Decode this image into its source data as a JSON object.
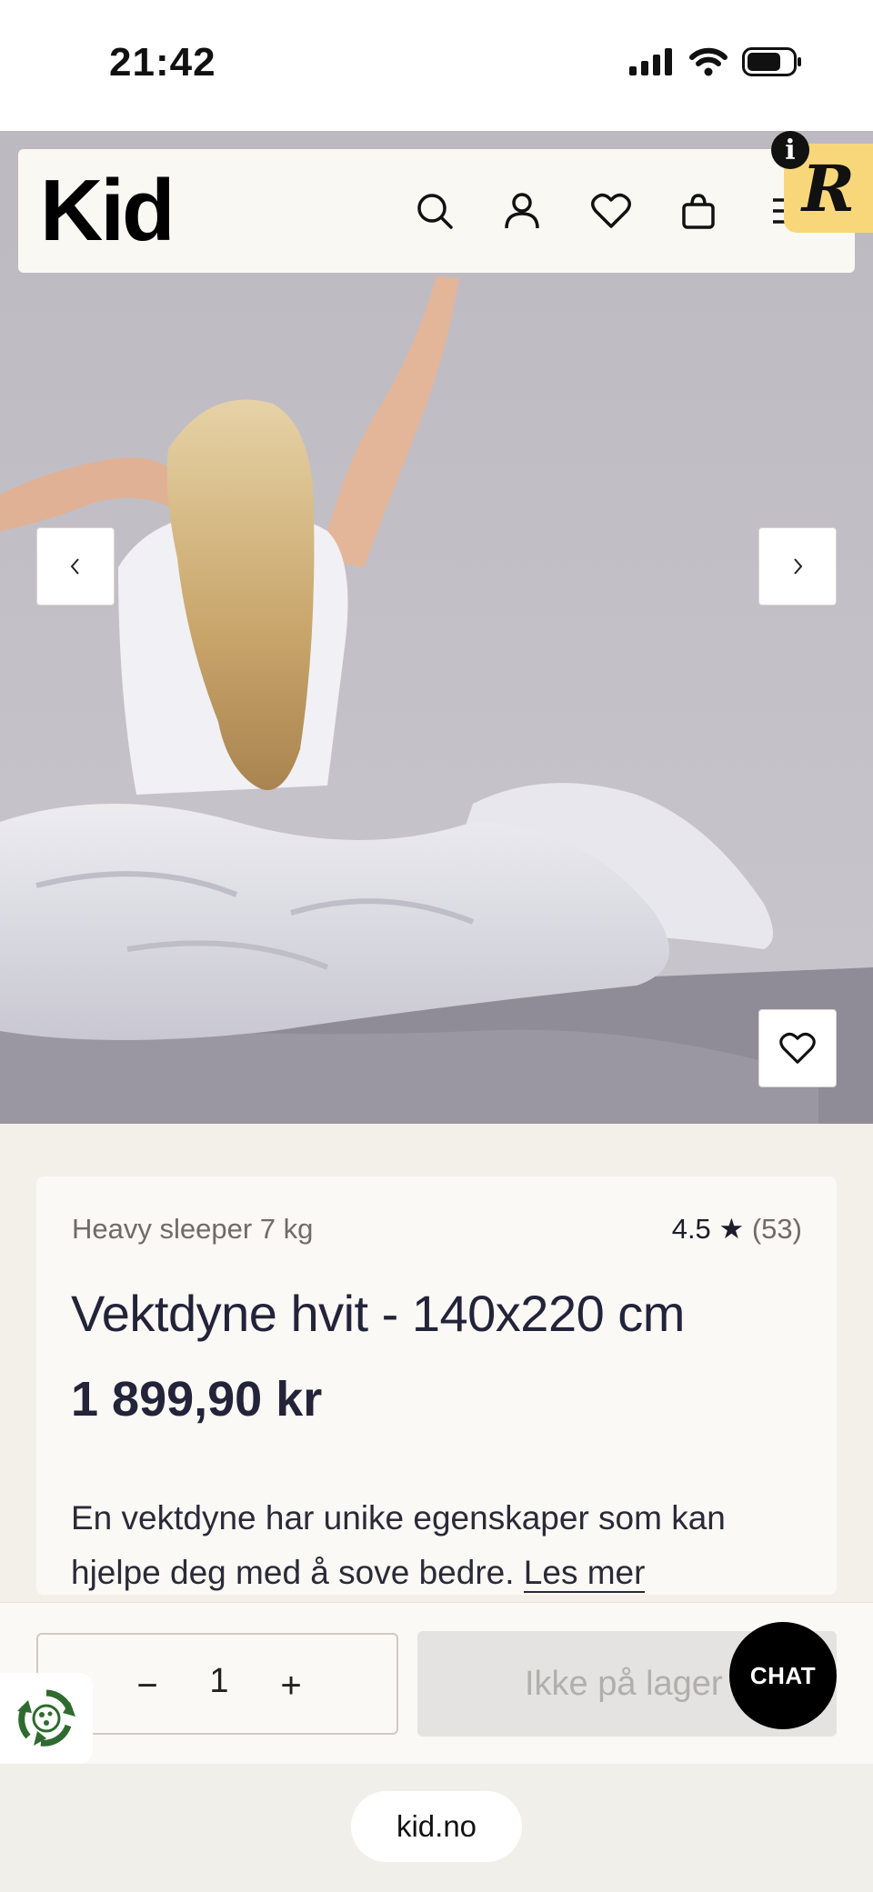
{
  "status_bar": {
    "time": "21:42"
  },
  "header": {
    "logo": "Kid",
    "icons": [
      "search-icon",
      "account-icon",
      "heart-icon",
      "bag-icon",
      "menu-icon"
    ],
    "badge_letter": "R",
    "info_letter": "i"
  },
  "carousel": {
    "prev": "‹",
    "next": "›"
  },
  "product": {
    "variant": "Heavy sleeper 7 kg",
    "rating": "4.5",
    "rating_star": "★",
    "rating_count": "(53)",
    "title": "Vektdyne hvit - 140x220 cm",
    "price": "1 899,90 kr",
    "description": "En vektdyne har unike egenskaper som kan hjelpe deg med å sove bedre.",
    "read_more": "Les mer"
  },
  "purchase": {
    "minus": "−",
    "quantity": "1",
    "plus": "+",
    "stock_label": "Ikke på lager",
    "chat_label": "CHAT"
  },
  "browser": {
    "url": "kid.no"
  },
  "colors": {
    "badge": "#f8d77a",
    "page_bg": "#f3f0ea",
    "card_bg": "#faf9f5",
    "chat_bg": "#000000",
    "recycle": "#2f6b2f"
  }
}
